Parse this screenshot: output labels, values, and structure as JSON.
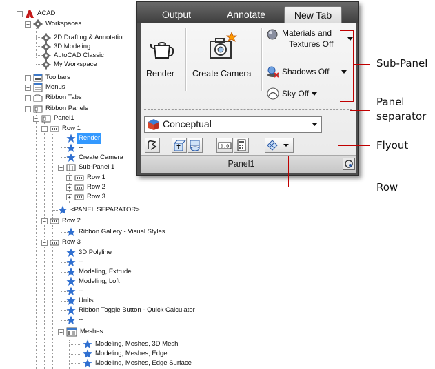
{
  "tree": {
    "acad": "ACAD",
    "workspaces": "Workspaces",
    "ws_2d": "2D Drafting & Annotation",
    "ws_3d": "3D Modeling",
    "ws_classic": "AutoCAD Classic",
    "ws_my": "My Workspace",
    "toolbars": "Toolbars",
    "menus": "Menus",
    "ribbon_tabs": "Ribbon Tabs",
    "ribbon_panels": "Ribbon Panels",
    "panel1": "Panel1",
    "row1": "Row 1",
    "render": "Render",
    "dash1": "--",
    "create_camera": "Create Camera",
    "subpanel1": "Sub-Panel 1",
    "sp_row1": "Row 1",
    "sp_row2": "Row 2",
    "sp_row3": "Row 3",
    "panel_separator": "<PANEL SEPARATOR>",
    "row2": "Row 2",
    "ribbon_gallery": "Ribbon Gallery - Visual Styles",
    "row3": "Row 3",
    "polyline": "3D Polyline",
    "dash2": "--",
    "extrude": "Modeling, Extrude",
    "loft": "Modeling, Loft",
    "dash3": "--",
    "units": "Units...",
    "toggle_calc": "Ribbon Toggle Button - Quick Calculator",
    "dash4": "--",
    "meshes": "Meshes",
    "mesh_3d": "Modeling, Meshes, 3D Mesh",
    "mesh_edge": "Modeling, Meshes, Edge",
    "mesh_edge_surface": "Modeling, Meshes, Edge Surface"
  },
  "ribbon": {
    "tabs": [
      "Output",
      "Annotate",
      "New Tab"
    ],
    "render_label": "Render",
    "camera_label": "Create Camera",
    "materials_line1": "Materials and",
    "materials_line2": "Textures Off",
    "shadows_label": "Shadows Off",
    "sky_label": "Sky Off",
    "visual_style": "Conceptual",
    "panel_title": "Panel1"
  },
  "callouts": {
    "subpanel": "Sub-Panel",
    "panel_sep_1": "Panel",
    "panel_sep_2": "separator",
    "flyout": "Flyout",
    "row": "Row"
  },
  "colors": {
    "callout_line": "#c00000",
    "selection": "#3399ff",
    "star_icon": "#2f6fd0",
    "visual_style_icon": "#d8452a"
  }
}
